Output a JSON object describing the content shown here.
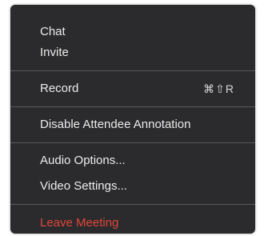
{
  "menu": {
    "items": [
      {
        "label": "Chat"
      },
      {
        "label": "Invite"
      },
      {
        "label": "Record",
        "shortcut": "⌘⇧R"
      },
      {
        "label": "Disable Attendee Annotation"
      },
      {
        "label": "Audio Options..."
      },
      {
        "label": "Video Settings..."
      },
      {
        "label": "Leave Meeting"
      }
    ]
  },
  "colors": {
    "menu_background": "#2b2b2d",
    "text": "#ececec",
    "danger": "#e0463a",
    "separator": "#5a5a5c"
  }
}
